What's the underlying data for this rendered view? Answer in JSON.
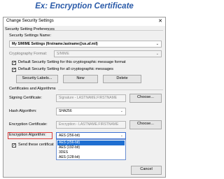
{
  "caption": "Ex: Encryption Certificate",
  "dialog": {
    "title": "Change Security Settings",
    "close_glyph": "✕",
    "group_prefs": "Security Setting Preferences",
    "name_label": "Security Settings Name:",
    "name_value": "My S/MIME Settings (firstname.lastname@us.af.mil)",
    "crypto_label": "Cryptography Format:",
    "crypto_value": "S/MIME",
    "chk_default_format": "Default Security Setting for this cryptographic message format",
    "chk_default_all": "Default Security Setting for all cryptographic messages",
    "btn_labels": "Security Labels...",
    "btn_new": "New",
    "btn_delete": "Delete",
    "group_certs": "Certificates and Algorithms",
    "signing_label": "Signing Certificate:",
    "signing_value": "Signature - LASTNAME.FIRSTNAME",
    "choose1": "Choose...",
    "hash_label": "Hash Algorithm:",
    "hash_value": "SHA256",
    "enc_cert_label": "Encryption Certificate:",
    "enc_cert_value": "Encryption - LASTNAME.FIRSTNAME",
    "choose2": "Choose...",
    "enc_alg_label": "Encryption Algorithm:",
    "enc_alg_value": "AES (256-bit)",
    "send_label": "Send these certificat",
    "cancel": "Cancel",
    "options": [
      "AES (256-bit)",
      "AES (192-bit)",
      "3DES",
      "AES (128-bit)"
    ]
  },
  "colors": {
    "caption": "#2a5aa8",
    "highlight": "#d83a3a",
    "selection": "#1f6fd1"
  }
}
